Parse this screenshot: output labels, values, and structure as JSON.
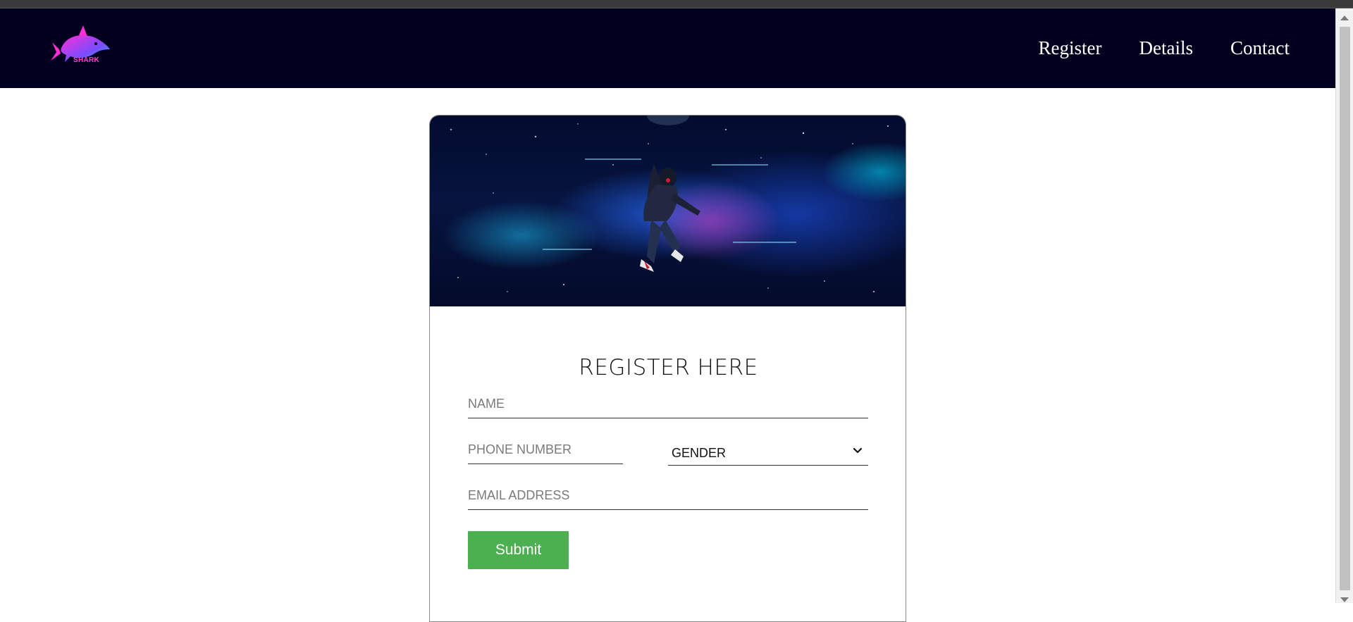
{
  "navbar": {
    "logo_text": "SHARK",
    "links": [
      "Register",
      "Details",
      "Contact"
    ]
  },
  "form": {
    "title": "REGISTER HERE",
    "name_placeholder": "NAME",
    "phone_placeholder": "PHONE NUMBER",
    "gender_value": "GENDER",
    "email_placeholder": "EMAIL ADDRESS",
    "submit_label": "Submit"
  },
  "colors": {
    "navbar_bg": "#02001f",
    "submit_bg": "#4caf50",
    "logo_accent": "#ff3fd0"
  }
}
